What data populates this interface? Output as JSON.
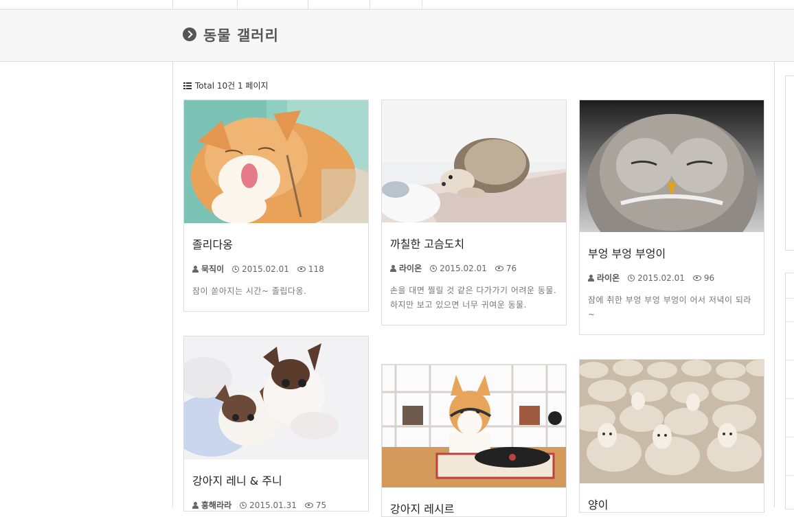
{
  "board": {
    "title": "동물 갤러리",
    "total_text": "Total 10건 1 페이지"
  },
  "cards": [
    {
      "title": "졸리다옹",
      "author": "묵직이",
      "date": "2015.02.01",
      "views": "118",
      "desc": "잠이 쏟아지는 시간~ 졸립다옹.",
      "image": "cat-photo"
    },
    {
      "title": "까칠한 고슴도치",
      "author": "라이온",
      "date": "2015.02.01",
      "views": "76",
      "desc": "손을 대면 찔릴 것 같은 다가가기 어려운 동물. 하지만 보고 있으면 너무 귀여운 동물.",
      "image": "hedgehog-photo"
    },
    {
      "title": "부엉 부엉 부엉이",
      "author": "라이온",
      "date": "2015.02.01",
      "views": "96",
      "desc": "잠에 취한 부엉 부엉 부엉이 어서 저녁이 되라~",
      "image": "owl-photo"
    },
    {
      "title": "강아지 레니 & 주니",
      "author": "흥해라라",
      "date": "2015.01.31",
      "views": "75",
      "desc": "",
      "image": "chihuahuas-photo"
    },
    {
      "title": "강아지 레시르",
      "author": "",
      "date": "",
      "views": "",
      "desc": "",
      "image": "corgi-photo"
    },
    {
      "title": "양이",
      "author": "",
      "date": "",
      "views": "",
      "desc": "",
      "image": "sheep-photo"
    }
  ],
  "colors": {
    "accent": "#555555",
    "border": "#dddddd",
    "band": "#f7f7f7"
  }
}
